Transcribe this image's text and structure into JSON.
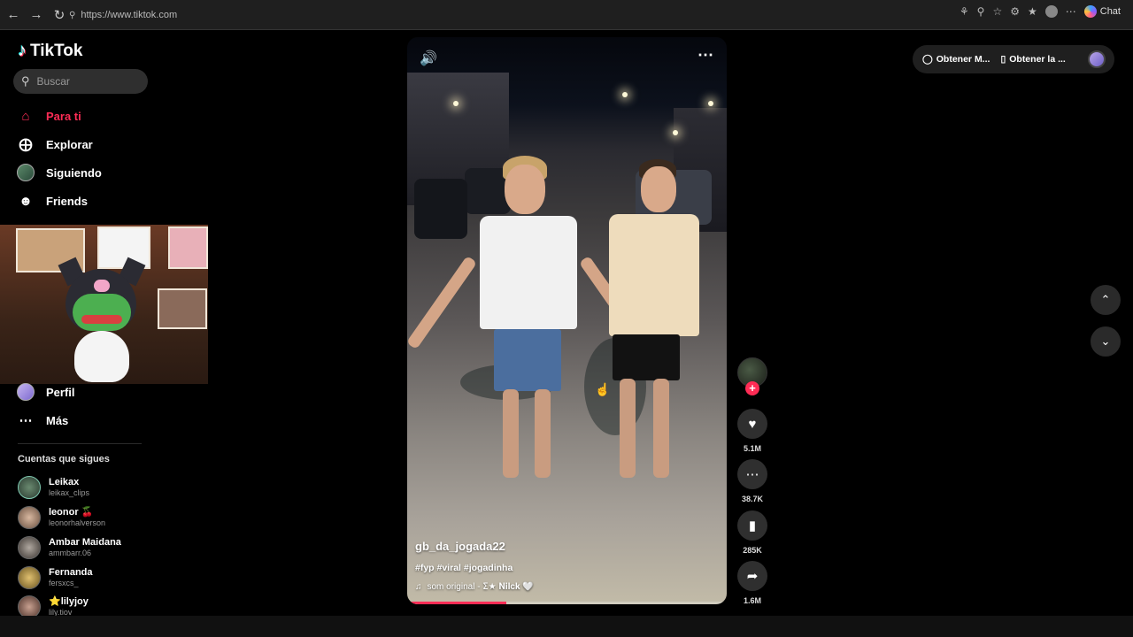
{
  "browser": {
    "url": "https://www.tiktok.com",
    "chat_label": "Chat"
  },
  "sidebar": {
    "logo_text": "TikTok",
    "search_placeholder": "Buscar",
    "nav": [
      {
        "label": "Para ti",
        "icon": "home-icon",
        "active": true
      },
      {
        "label": "Explorar",
        "icon": "compass-icon",
        "active": false
      },
      {
        "label": "Siguiendo",
        "icon": "avatar",
        "active": false
      },
      {
        "label": "Friends",
        "icon": "friends-icon",
        "active": false
      },
      {
        "label": "Perfil",
        "icon": "avatar",
        "active": false
      },
      {
        "label": "Más",
        "icon": "more-icon",
        "active": false
      }
    ],
    "following_title": "Cuentas que sigues",
    "following": [
      {
        "name": "Leikax",
        "handle": "leikax_clips"
      },
      {
        "name": "leonor 🍒",
        "handle": "leonorhalverson"
      },
      {
        "name": "Ambar Maidana",
        "handle": "ammbarr.06"
      },
      {
        "name": "Fernanda",
        "handle": "fersxcs_"
      },
      {
        "name": "⭐lilyjoy",
        "handle": "lily.tiov"
      }
    ]
  },
  "video": {
    "author": "gb_da_jogada22",
    "tags": "#fyp #viral #jogadinha",
    "music": "som original - ⵉ★ 𝐍𝐢𝐥𝐜𝐤 🤍",
    "progress": 0.31
  },
  "actions": {
    "likes": "5.1M",
    "comments": "38.7K",
    "saves": "285K",
    "shares": "1.6M"
  },
  "topbar": {
    "get_coins": "Obtener M...",
    "get_app": "Obtener la ..."
  },
  "colors": {
    "accent": "#fe2c55",
    "background": "#000000",
    "panel": "#2f2f2f"
  }
}
